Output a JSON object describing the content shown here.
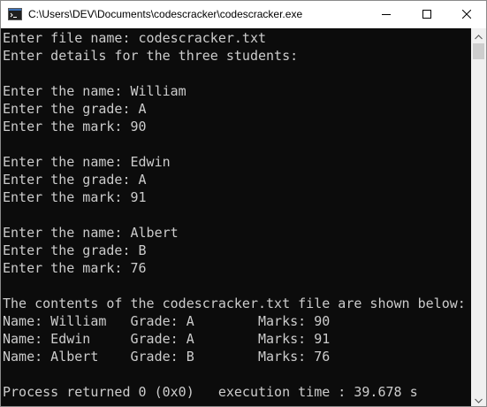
{
  "window": {
    "title": "C:\\Users\\DEV\\Documents\\codescracker\\codescracker.exe",
    "icons": {
      "app": "console-app-icon",
      "minimize": "minimize-icon",
      "maximize": "maximize-icon",
      "close": "close-icon",
      "scroll_up": "chevron-up-icon",
      "scroll_down": "chevron-down-icon"
    },
    "colors": {
      "titlebar_bg": "#ffffff",
      "console_bg": "#0c0c0c",
      "console_text": "#cccccc",
      "scrollbar_bg": "#f0f0f0"
    }
  },
  "console": {
    "lines": [
      "Enter file name: codescracker.txt",
      "Enter details for the three students:",
      "",
      "Enter the name: William",
      "Enter the grade: A",
      "Enter the mark: 90",
      "",
      "Enter the name: Edwin",
      "Enter the grade: A",
      "Enter the mark: 91",
      "",
      "Enter the name: Albert",
      "Enter the grade: B",
      "Enter the mark: 76",
      "",
      "The contents of the codescracker.txt file are shown below:",
      "Name: William   Grade: A        Marks: 90",
      "Name: Edwin     Grade: A        Marks: 91",
      "Name: Albert    Grade: B        Marks: 76",
      "",
      "Process returned 0 (0x0)   execution time : 39.678 s"
    ]
  }
}
